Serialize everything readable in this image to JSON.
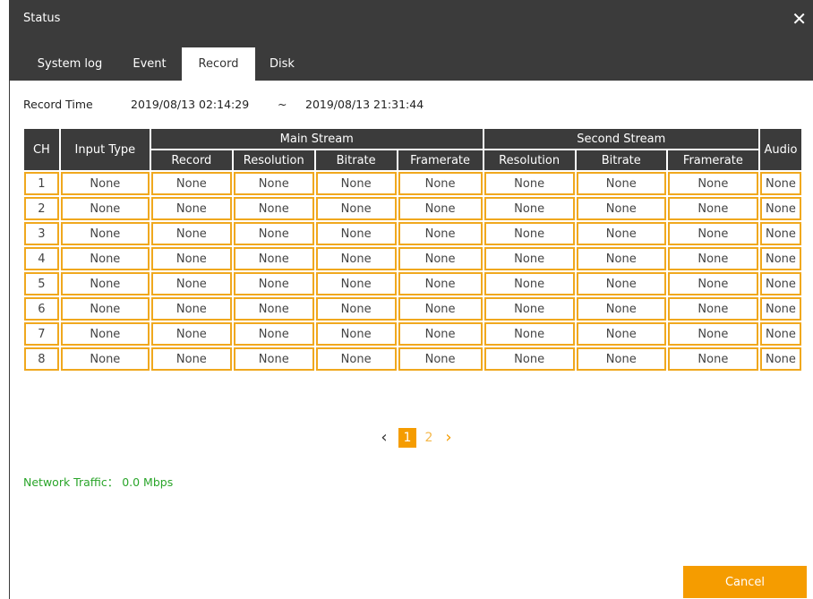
{
  "window": {
    "title": "Status",
    "close_glyph": "✕",
    "close_icon": "close-icon"
  },
  "tabs": [
    {
      "label": "System log"
    },
    {
      "label": "Event"
    },
    {
      "label": "Record",
      "active": true
    },
    {
      "label": "Disk"
    }
  ],
  "record_time": {
    "label": "Record Time",
    "start": "2019/08/13 02:14:29",
    "separator": "~",
    "end": "2019/08/13 21:31:44"
  },
  "table": {
    "headers": {
      "ch": "CH",
      "input_type": "Input Type",
      "main_stream": "Main Stream",
      "second_stream": "Second Stream",
      "audio": "Audio",
      "main_cols": [
        "Record",
        "Resolution",
        "Bitrate",
        "Framerate"
      ],
      "second_cols": [
        "Resolution",
        "Bitrate",
        "Framerate"
      ]
    },
    "rows": [
      {
        "ch": "1",
        "input_type": "None",
        "main_record": "None",
        "main_resolution": "None",
        "main_bitrate": "None",
        "main_framerate": "None",
        "second_resolution": "None",
        "second_bitrate": "None",
        "second_framerate": "None",
        "audio": "None"
      },
      {
        "ch": "2",
        "input_type": "None",
        "main_record": "None",
        "main_resolution": "None",
        "main_bitrate": "None",
        "main_framerate": "None",
        "second_resolution": "None",
        "second_bitrate": "None",
        "second_framerate": "None",
        "audio": "None"
      },
      {
        "ch": "3",
        "input_type": "None",
        "main_record": "None",
        "main_resolution": "None",
        "main_bitrate": "None",
        "main_framerate": "None",
        "second_resolution": "None",
        "second_bitrate": "None",
        "second_framerate": "None",
        "audio": "None"
      },
      {
        "ch": "4",
        "input_type": "None",
        "main_record": "None",
        "main_resolution": "None",
        "main_bitrate": "None",
        "main_framerate": "None",
        "second_resolution": "None",
        "second_bitrate": "None",
        "second_framerate": "None",
        "audio": "None"
      },
      {
        "ch": "5",
        "input_type": "None",
        "main_record": "None",
        "main_resolution": "None",
        "main_bitrate": "None",
        "main_framerate": "None",
        "second_resolution": "None",
        "second_bitrate": "None",
        "second_framerate": "None",
        "audio": "None"
      },
      {
        "ch": "6",
        "input_type": "None",
        "main_record": "None",
        "main_resolution": "None",
        "main_bitrate": "None",
        "main_framerate": "None",
        "second_resolution": "None",
        "second_bitrate": "None",
        "second_framerate": "None",
        "audio": "None"
      },
      {
        "ch": "7",
        "input_type": "None",
        "main_record": "None",
        "main_resolution": "None",
        "main_bitrate": "None",
        "main_framerate": "None",
        "second_resolution": "None",
        "second_bitrate": "None",
        "second_framerate": "None",
        "audio": "None"
      },
      {
        "ch": "8",
        "input_type": "None",
        "main_record": "None",
        "main_resolution": "None",
        "main_bitrate": "None",
        "main_framerate": "None",
        "second_resolution": "None",
        "second_bitrate": "None",
        "second_framerate": "None",
        "audio": "None"
      }
    ]
  },
  "pagination": {
    "prev_glyph": "‹",
    "next_glyph": "›",
    "prev_icon": "chevron-left-icon",
    "next_icon": "chevron-right-icon",
    "pages": [
      {
        "label": "1",
        "active": true
      },
      {
        "label": "2",
        "active": false
      }
    ]
  },
  "network": {
    "text": "Network Traffic： 0.0 Mbps"
  },
  "buttons": {
    "cancel": "Cancel"
  },
  "colors": {
    "titlebar": "#3b3b3b",
    "accent": "#f59c00",
    "cell_border": "#f0a81e",
    "traffic_text": "#2aa52a",
    "page_inactive": "#f5b84a"
  }
}
